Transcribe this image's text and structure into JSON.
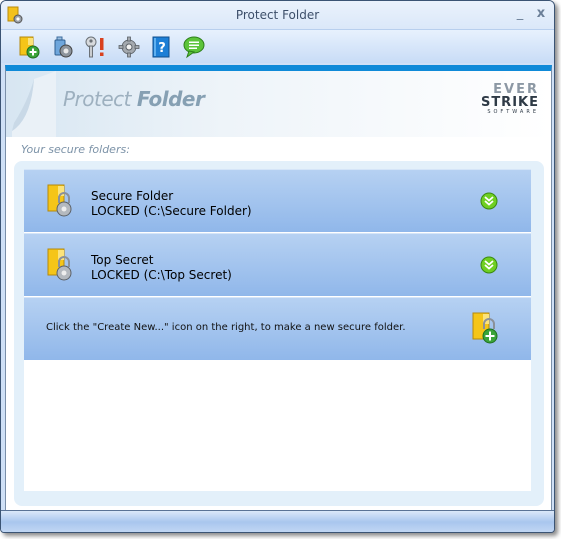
{
  "window": {
    "title": "Protect Folder",
    "app_icon": "folder-lock-icon",
    "minimize_label": "_",
    "close_label": "x"
  },
  "toolbar": {
    "buttons": [
      {
        "name": "create-new-button",
        "icon": "folder-add-icon"
      },
      {
        "name": "usb-lock-button",
        "icon": "usb-lock-icon"
      },
      {
        "name": "password-button",
        "icon": "key-alert-icon"
      },
      {
        "name": "settings-button",
        "icon": "gear-icon"
      },
      {
        "name": "help-button",
        "icon": "help-book-icon"
      },
      {
        "name": "feedback-button",
        "icon": "chat-bubble-icon"
      }
    ]
  },
  "banner": {
    "title_word1": "Protect",
    "title_word2": "Folder",
    "logo_line1": "EVER",
    "logo_line2": "STRIKE",
    "logo_line3": "SOFTWARE"
  },
  "section_label": "Your secure folders:",
  "folders": [
    {
      "name": "Secure Folder",
      "status": "LOCKED (C:\\Secure Folder)"
    },
    {
      "name": "Top Secret",
      "status": "LOCKED (C:\\Top Secret)"
    }
  ],
  "create_hint": "Click the \"Create New...\" icon on the right, to make a new secure folder.",
  "colors": {
    "accent_bar": "#0f8ad8",
    "item_gradient_top": "#b6d1f2",
    "item_gradient_bottom": "#90b7ea",
    "panel_bg": "#e3f0fa"
  }
}
